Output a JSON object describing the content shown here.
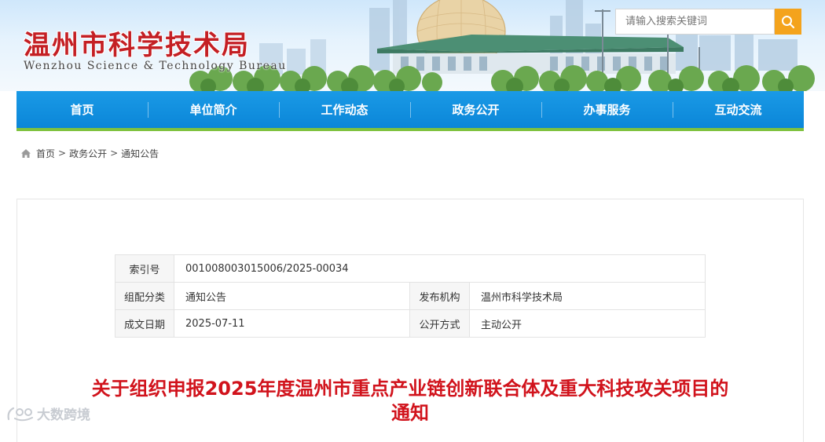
{
  "header": {
    "title": "温州市科学技术局",
    "subtitle": "Wenzhou Science & Technology Bureau",
    "search": {
      "placeholder": "请输入搜索关键词"
    },
    "colors": {
      "title": "#c41f24",
      "search_button": "#f4a31c"
    }
  },
  "nav": {
    "items": [
      "首页",
      "单位简介",
      "工作动态",
      "政务公开",
      "办事服务",
      "互动交流"
    ],
    "colors": {
      "bar": "#0b86d8",
      "underline": "#7fc23f"
    }
  },
  "breadcrumb": {
    "items": [
      "首页",
      "政务公开",
      "通知公告"
    ],
    "separator": ">"
  },
  "info_table": {
    "index_label": "索引号",
    "index_value": "001008003015006/2025-00034",
    "category_label": "组配分类",
    "category_value": "通知公告",
    "publisher_label": "发布机构",
    "publisher_value": "温州市科学技术局",
    "date_label": "成文日期",
    "date_value": "2025-07-11",
    "disclosure_label": "公开方式",
    "disclosure_value": "主动公开"
  },
  "article": {
    "title_line1": "关于组织申报2025年度温州市重点产业链创新联合体及重大科技攻关项目的",
    "title_line2": "通知",
    "color": "#d1131c"
  },
  "watermark": {
    "text": "大数跨境"
  }
}
